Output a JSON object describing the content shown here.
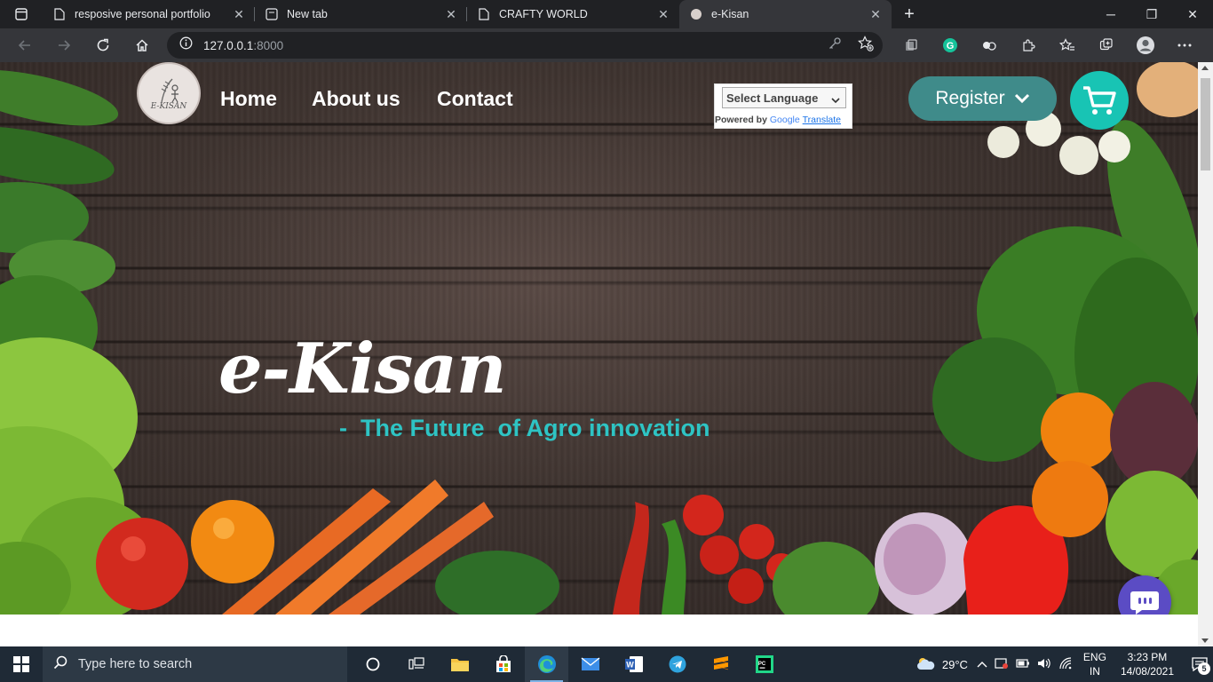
{
  "browser": {
    "tabs": [
      {
        "title": "resposive personal portfolio",
        "active": false
      },
      {
        "title": "New tab",
        "active": false
      },
      {
        "title": "CRAFTY WORLD",
        "active": false
      },
      {
        "title": "e-Kisan",
        "active": true
      }
    ],
    "url_host": "127.0.0.1",
    "url_port": ":8000"
  },
  "site": {
    "logo_text": "E-KISAN",
    "nav": {
      "home": "Home",
      "about": "About us",
      "contact": "Contact"
    },
    "translate": {
      "select_label": "Select Language",
      "powered_by": "Powered by",
      "google": "Google",
      "translate_link": "Translate"
    },
    "register_label": "Register",
    "hero_title": "e-Kisan",
    "hero_subtitle": "-  The Future  of Agro innovation",
    "colors": {
      "accent": "#2ec4c4",
      "register_bg": "#3f8b8a",
      "cart_bg": "#18c4b4",
      "chat_bg": "#5b4cc4"
    }
  },
  "taskbar": {
    "search_placeholder": "Type here to search",
    "weather": "29°C",
    "lang_top": "ENG",
    "lang_bottom": "IN",
    "time": "3:23 PM",
    "date": "14/08/2021",
    "notifications": "5"
  }
}
